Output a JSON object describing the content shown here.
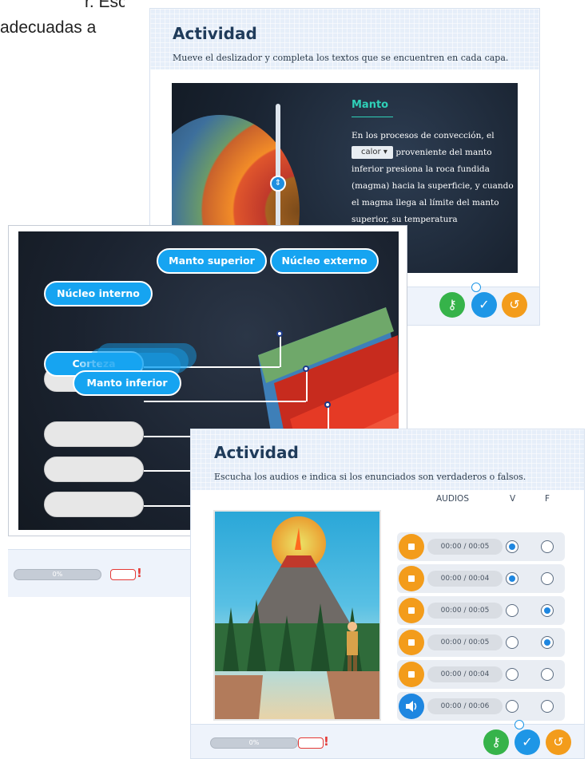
{
  "background_text": {
    "line1": "r. Escuche",
    "line2": "adecuadas a"
  },
  "panel_layers": {
    "title": "Actividad",
    "subtitle": "Mueve el deslizador y completa los textos que se encuentren en cada capa.",
    "layer_title": "Manto",
    "text_before": "En los procesos de convección, el",
    "dropdown_value": "calor",
    "text_after": "proveniente del manto inferior presiona la roca fundida (magma) hacia la superficie, y cuando el magma llega al límite del manto superior, su temperatura"
  },
  "panel_labels": {
    "options": {
      "manto_superior": "Manto superior",
      "nucleo_externo": "Núcleo externo",
      "nucleo_interno": "Núcleo interno",
      "corteza": "Corteza",
      "manto_inferior": "Manto inferior"
    },
    "progress": "0%"
  },
  "panel_audio": {
    "title": "Actividad",
    "subtitle": "Escucha los audios e indica si los enunciados son verdaderos o falsos.",
    "col_audios": "AUDIOS",
    "col_v": "V",
    "col_f": "F",
    "rows": [
      {
        "time": "00:00 / 00:05",
        "selected": "V",
        "button": "stop"
      },
      {
        "time": "00:00 / 00:04",
        "selected": "V",
        "button": "stop"
      },
      {
        "time": "00:00 / 00:05",
        "selected": "F",
        "button": "stop"
      },
      {
        "time": "00:00 / 00:05",
        "selected": "F",
        "button": "stop"
      },
      {
        "time": "00:00 / 00:04",
        "selected": "none",
        "button": "stop"
      },
      {
        "time": "00:00 / 00:06",
        "selected": "none",
        "button": "speaker"
      }
    ],
    "progress": "0%"
  },
  "colors": {
    "key_button": "#36b34a",
    "check_button": "#1e96e6",
    "reset_button": "#f39c1b",
    "label_pill": "#16a4f1",
    "alert": "#e53935"
  }
}
